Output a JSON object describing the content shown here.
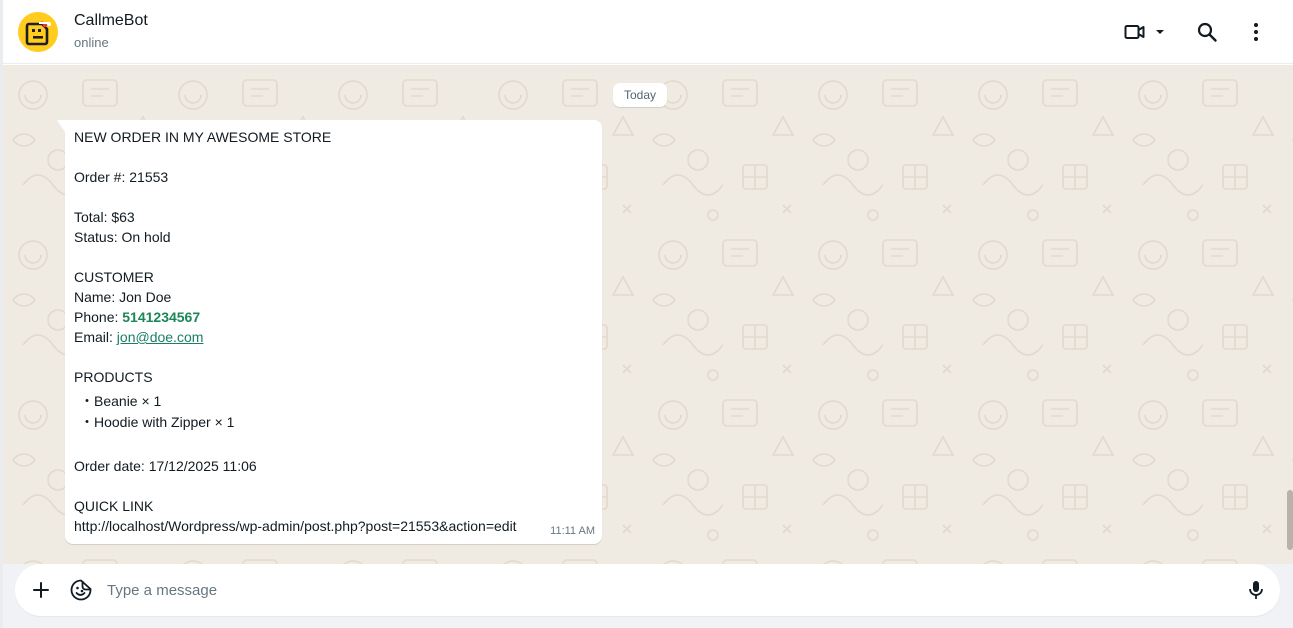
{
  "header": {
    "contact_name": "CallmeBot",
    "contact_status": "online",
    "icons": [
      "video-call-icon",
      "chevron-down-icon",
      "search-icon",
      "more-vertical-icon"
    ]
  },
  "chat": {
    "date_chip": "Today",
    "message": {
      "title": "NEW ORDER IN MY AWESOME STORE",
      "order_number": "Order #: 21553",
      "total": "Total: $63",
      "status": "Status: On hold",
      "customer_heading": "CUSTOMER",
      "name": "Name: Jon Doe",
      "phone_label": "Phone: ",
      "phone_value": "5141234567",
      "email_label": "Email: ",
      "email_value": "jon@doe.com",
      "products_heading": "PRODUCTS",
      "products": [
        "・Beanie × 1",
        "・Hoodie with Zipper × 1"
      ],
      "order_date": "Order date: 17/12/2025 11:06",
      "quick_link_heading": "QUICK LINK",
      "quick_link_url": "http://localhost/Wordpress/wp-admin/post.php?post=21553&action=edit",
      "time": "11:11 AM"
    }
  },
  "composer": {
    "placeholder": "Type a message",
    "icons": [
      "plus-icon",
      "sticker-icon",
      "microphone-icon"
    ]
  },
  "colors": {
    "chat_background": "#efeae2",
    "bubble": "#ffffff",
    "phone_link": "#1b8755",
    "email_link": "#1a7f64",
    "avatar_bg": "#ffcc1f"
  }
}
